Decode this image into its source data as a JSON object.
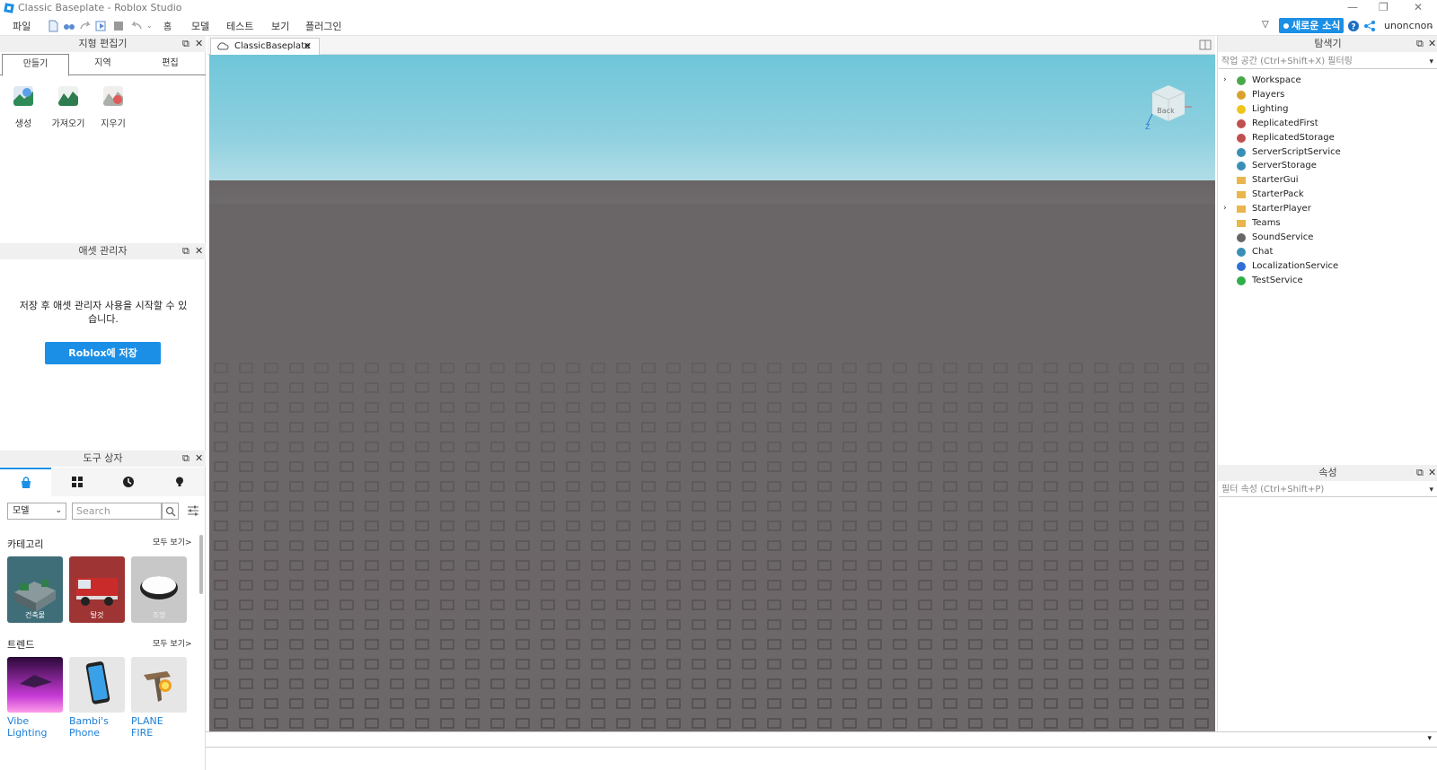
{
  "window": {
    "title": "Classic Baseplate - Roblox Studio",
    "controls": [
      "—",
      "❐",
      "✕"
    ]
  },
  "menu": {
    "file": "파일",
    "items": [
      "모델",
      "테스트",
      "보기",
      "플러그인"
    ],
    "hat_icon": "홈",
    "news_button": "새로운 소식",
    "username": "unoncnon"
  },
  "terrain_editor": {
    "title": "지형 편집기",
    "tabs": [
      "만들기",
      "지역",
      "편집"
    ],
    "tools": [
      {
        "label": "생성",
        "icon": "generate-terrain-icon"
      },
      {
        "label": "가져오기",
        "icon": "import-terrain-icon"
      },
      {
        "label": "지우기",
        "icon": "clear-terrain-icon"
      }
    ]
  },
  "asset_manager": {
    "title": "애셋 관리자",
    "message": "저장 후 애셋 관리자 사용을 시작할 수 있습니다.",
    "save_button": "Roblox에 저장"
  },
  "toolbox": {
    "title": "도구 상자",
    "tab_icons": [
      "marketplace-bag-icon",
      "inventory-grid-icon",
      "recent-clock-icon",
      "creations-bulb-icon"
    ],
    "category_select": "모델",
    "search_placeholder": "Search",
    "sections": [
      {
        "title": "카테고리",
        "see_all": "모두 보기>",
        "items": [
          {
            "label": "건축물",
            "color": "#4b7a86"
          },
          {
            "label": "탈것",
            "color": "#a83a3a"
          },
          {
            "label": "조명",
            "color": "#c9c9c9"
          }
        ]
      },
      {
        "title": "트렌드",
        "see_all": "모두 보기>",
        "items": [
          {
            "label": "Vibe Lighting"
          },
          {
            "label": "Bambi's Phone"
          },
          {
            "label": "PLANE FIRE"
          }
        ]
      }
    ]
  },
  "document": {
    "tab_label": "ClassicBaseplate"
  },
  "explorer": {
    "title": "탐색기",
    "filter_placeholder": "작업 공간 (Ctrl+Shift+X) 필터링",
    "items": [
      {
        "label": "Workspace",
        "expandable": true,
        "icon": "workspace-globe-icon",
        "color": "#4aa84a"
      },
      {
        "label": "Players",
        "expandable": false,
        "icon": "players-icon",
        "color": "#d9a22d"
      },
      {
        "label": "Lighting",
        "expandable": false,
        "icon": "lighting-bulb-icon",
        "color": "#f0c419"
      },
      {
        "label": "ReplicatedFirst",
        "expandable": false,
        "icon": "replicated-first-icon",
        "color": "#c0504d"
      },
      {
        "label": "ReplicatedStorage",
        "expandable": false,
        "icon": "replicated-storage-icon",
        "color": "#c0504d"
      },
      {
        "label": "ServerScriptService",
        "expandable": false,
        "icon": "server-script-service-icon",
        "color": "#3a8fb7"
      },
      {
        "label": "ServerStorage",
        "expandable": false,
        "icon": "server-storage-icon",
        "color": "#3a8fb7"
      },
      {
        "label": "StarterGui",
        "expandable": false,
        "icon": "starter-gui-folder-icon",
        "color": "#e8b64c"
      },
      {
        "label": "StarterPack",
        "expandable": false,
        "icon": "starter-pack-folder-icon",
        "color": "#e8b64c"
      },
      {
        "label": "StarterPlayer",
        "expandable": true,
        "icon": "starter-player-folder-icon",
        "color": "#e8b64c"
      },
      {
        "label": "Teams",
        "expandable": false,
        "icon": "teams-folder-icon",
        "color": "#e8b64c"
      },
      {
        "label": "SoundService",
        "expandable": false,
        "icon": "sound-speaker-icon",
        "color": "#666666"
      },
      {
        "label": "Chat",
        "expandable": false,
        "icon": "chat-bubble-icon",
        "color": "#3a8fb7"
      },
      {
        "label": "LocalizationService",
        "expandable": false,
        "icon": "localization-globe-icon",
        "color": "#2f6fd6"
      },
      {
        "label": "TestService",
        "expandable": false,
        "icon": "test-check-icon",
        "color": "#2fae4a"
      }
    ]
  },
  "properties": {
    "title": "속성",
    "filter_placeholder": "필터 속성 (Ctrl+Shift+P)"
  },
  "viewcube": {
    "face_label": "Back",
    "axis_label": "Z"
  }
}
